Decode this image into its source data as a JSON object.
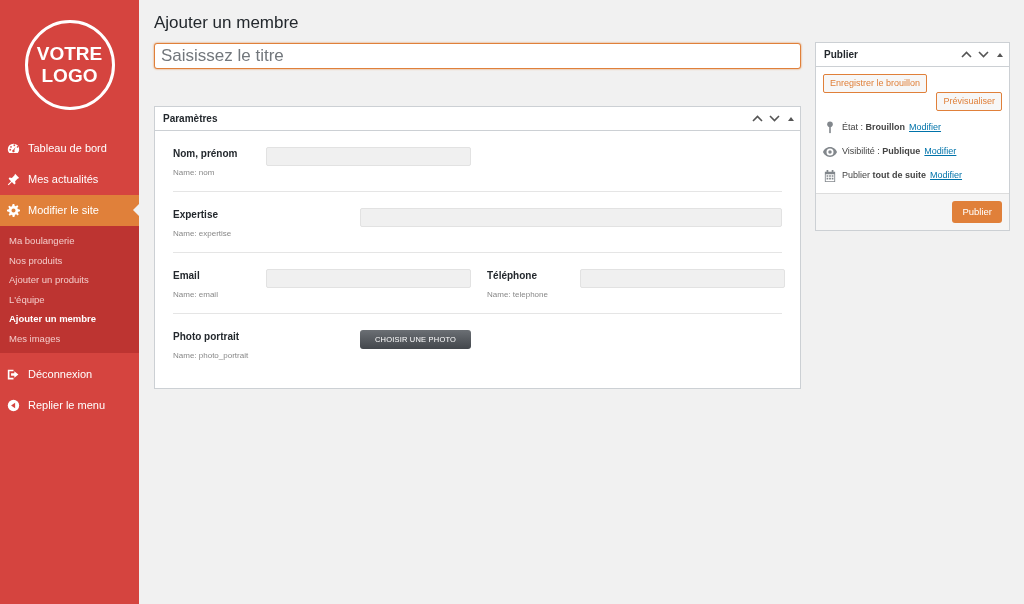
{
  "sidebar": {
    "logo": [
      "VOTRE",
      "LOGO"
    ],
    "items": [
      {
        "label": "Tableau de bord",
        "selected": false
      },
      {
        "label": "Mes actualités",
        "selected": false
      },
      {
        "label": "Modifier le site",
        "selected": true,
        "children": [
          {
            "label": "Ma boulangerie",
            "selected": false
          },
          {
            "label": "Nos produits",
            "selected": false
          },
          {
            "label": "Ajouter un produits",
            "selected": false
          },
          {
            "label": "L'équipe",
            "selected": false
          },
          {
            "label": "Ajouter un membre",
            "selected": true
          },
          {
            "label": "Mes images",
            "selected": false
          }
        ]
      },
      {
        "label": "Déconnexion",
        "selected": false
      },
      {
        "label": "Replier le menu",
        "selected": false
      }
    ]
  },
  "page_title": "Ajouter un membre",
  "title_field": {
    "placeholder": "Saisissez le titre"
  },
  "parametres": {
    "title": "Paramètres",
    "rows": [
      [
        {
          "kind": "text",
          "label": "Nom, prénom",
          "name_hint": "Name: nom"
        }
      ],
      [
        {
          "kind": "wide",
          "label": "Expertise",
          "name_hint": "Name: expertise"
        }
      ],
      [
        {
          "kind": "text",
          "label": "Email",
          "name_hint": "Name: email"
        },
        {
          "kind": "text",
          "label": "Téléphone",
          "name_hint": "Name: telephone"
        }
      ],
      [
        {
          "kind": "upload",
          "label": "Photo portrait",
          "name_hint": "Name: photo_portrait",
          "button": "CHOISIR UNE PHOTO"
        }
      ]
    ]
  },
  "publier": {
    "title": "Publier",
    "save_draft": "Enregistrer le brouillon",
    "preview": "Prévisualiser",
    "lines": [
      {
        "text": "État : **Brouillon**",
        "link": "Modifier"
      },
      {
        "text": "Visibilité : **Publique**",
        "link": "Modifier"
      },
      {
        "text": "Publier **tout de suite**",
        "link": "Modifier"
      }
    ],
    "publish": "Publier"
  }
}
